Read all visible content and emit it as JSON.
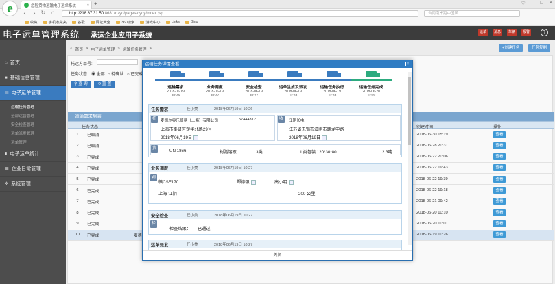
{
  "browser": {
    "tab_title": "危险货物运输电子运单系统",
    "url_host": "http://218.87.31.50",
    "url_path": ":8681/dzyd/pages/cyqy/index.jsp",
    "search_placeholder": "台南南岸距中国风",
    "bookmarks": [
      "收藏",
      "手机收藏夹",
      "谷歌",
      "网址大全",
      "360搜索",
      "游戏中心",
      "Links",
      "Bing"
    ]
  },
  "app": {
    "name": "电子运单管理系统",
    "subsystem": "承运企业应用子系统",
    "header_btns": [
      "运单",
      "消息",
      "车辆",
      "报警"
    ]
  },
  "sidebar": {
    "items": [
      {
        "label": "首页",
        "icon": "home-icon"
      },
      {
        "label": "基础信息管理",
        "icon": "bookmark-icon"
      },
      {
        "label": "电子运单管理",
        "icon": "document-icon"
      },
      {
        "label": "电子运单统计",
        "icon": "chart-icon"
      },
      {
        "label": "企业日常管理",
        "icon": "calendar-icon"
      },
      {
        "label": "系统管理",
        "icon": "gear-icon"
      }
    ],
    "subitems": [
      "运输任务管理",
      "全部运营管理",
      "安全检查管理",
      "运单派发管理",
      "运单管理"
    ]
  },
  "breadcrumb": [
    "首页",
    "电子运单管理",
    "运输任务管理"
  ],
  "toolbar": {
    "create": "+创建任务",
    "copy": "任务复制"
  },
  "filter": {
    "label_no": "托运方单号:",
    "label_status": "任务状态：",
    "radio_all": "全部",
    "radio_pending": "待确认",
    "radio_done": "已完成",
    "query": "查 询",
    "reset": "重 置"
  },
  "list": {
    "title": "运输需求列表",
    "col_status": "任务状态",
    "col_time": "创建时间",
    "col_action": "操作",
    "rows": [
      {
        "no": "1",
        "status": "已取消",
        "time": "2018-06-30 15:19",
        "extra": ""
      },
      {
        "no": "2",
        "status": "已取消",
        "time": "2018-06-28 20:31",
        "extra": ""
      },
      {
        "no": "3",
        "status": "已完成",
        "time": "2018-06-22 20:06",
        "extra": ""
      },
      {
        "no": "4",
        "status": "已完成",
        "time": "2018-06-22 19:43",
        "extra": ""
      },
      {
        "no": "5",
        "status": "已完成",
        "time": "2018-06-22 19:39",
        "extra": ""
      },
      {
        "no": "6",
        "status": "已完成",
        "time": "2018-06-22 19:18",
        "extra": ""
      },
      {
        "no": "7",
        "status": "已完成",
        "time": "2018-06-21 09:42",
        "extra": ""
      },
      {
        "no": "8",
        "status": "已完成",
        "time": "2018-06-20 10:10",
        "extra": ""
      },
      {
        "no": "9",
        "status": "已完成",
        "time": "2018-06-20 10:01",
        "extra": ""
      },
      {
        "no": "10",
        "status": "已完成",
        "time": "2018-06-19 10:26",
        "extra": "麦德"
      }
    ],
    "view": "查看"
  },
  "modal": {
    "title": "运输任务详情查看",
    "steps": [
      {
        "name": "运输需求",
        "date": "2018-06-19",
        "time": "10:26"
      },
      {
        "name": "业务调度",
        "date": "2018-06-19",
        "time": "10:27"
      },
      {
        "name": "安全检查",
        "date": "2018-06-19",
        "time": "10:27"
      },
      {
        "name": "运单生成及派发",
        "date": "2018-06-19",
        "time": "10:28"
      },
      {
        "name": "运输任务执行",
        "date": "2018-06-19",
        "time": "10:28"
      },
      {
        "name": "运输任务完成",
        "date": "2018-06-20",
        "time": "10:09"
      }
    ],
    "demand": {
      "title": "任务需求",
      "user": "任小美",
      "datetime": "2018年06月19日 10:26",
      "shipper_badge": "托",
      "shipper": "麦德尔奥乐贸易（上海）有限公司",
      "shipper_phone": "57444312",
      "shipper_addr": "上海市奉贤区楚华北路29号",
      "shipper_date": "2018年06月19日",
      "receiver_badge": "收",
      "receiver": "江阴长电",
      "receiver_addr": "江苏省无锡市江阴市螺龙中路",
      "receiver_date": "2018年06月19日",
      "goods_badge": "货",
      "un": "UN 1866",
      "goods_name": "树脂溶液",
      "class": "3类",
      "pack": "I 类包装 120*30*80",
      "weight": "2.3吨"
    },
    "dispatch": {
      "title": "业务调度",
      "user": "任小美",
      "datetime": "2018年06月19日 10:27",
      "badge": "调",
      "plate": "赣CSE170",
      "driver": "郑德强",
      "escort": "高小明",
      "route": "上海-江阴",
      "distance": "200 公里"
    },
    "safety": {
      "title": "安全检查",
      "user": "任小美",
      "datetime": "2018年06月19日 10:27",
      "badge": "检",
      "result_label": "检查结果：",
      "result": "已通过"
    },
    "issue": {
      "title": "运单派发",
      "user": "任小美",
      "datetime": "2018年06月19日 10:27"
    },
    "close": "关闭"
  }
}
